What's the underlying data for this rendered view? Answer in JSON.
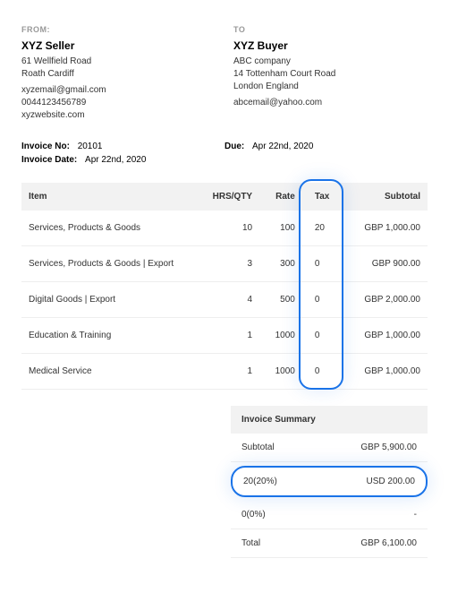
{
  "from_label": "FROM:",
  "to_label": "TO",
  "seller": {
    "name": "XYZ Seller",
    "addr1": "61 Wellfield Road",
    "addr2": "Roath Cardiff",
    "email": "xyzemail@gmail.com",
    "phone": "0044123456789",
    "web": "xyzwebsite.com"
  },
  "buyer": {
    "name": "XYZ Buyer",
    "company": "ABC company",
    "addr1": "14 Tottenham Court Road",
    "addr2": "London England",
    "email": "abcemail@yahoo.com"
  },
  "invoice_no_label": "Invoice No:",
  "invoice_no": "20101",
  "invoice_date_label": "Invoice Date:",
  "invoice_date": "Apr 22nd, 2020",
  "due_label": "Due:",
  "due_date": "Apr 22nd, 2020",
  "headers": {
    "item": "Item",
    "qty": "HRS/QTY",
    "rate": "Rate",
    "tax": "Tax",
    "subtotal": "Subtotal"
  },
  "items": [
    {
      "name": "Services, Products & Goods",
      "qty": "10",
      "rate": "100",
      "tax": "20",
      "subtotal": "GBP 1,000.00"
    },
    {
      "name": "Services, Products & Goods | Export",
      "qty": "3",
      "rate": "300",
      "tax": "0",
      "subtotal": "GBP 900.00"
    },
    {
      "name": "Digital Goods | Export",
      "qty": "4",
      "rate": "500",
      "tax": "0",
      "subtotal": "GBP 2,000.00"
    },
    {
      "name": "Education & Training",
      "qty": "1",
      "rate": "1000",
      "tax": "0",
      "subtotal": "GBP 1,000.00"
    },
    {
      "name": "Medical Service",
      "qty": "1",
      "rate": "1000",
      "tax": "0",
      "subtotal": "GBP 1,000.00"
    }
  ],
  "summary": {
    "title": "Invoice Summary",
    "subtotal_label": "Subtotal",
    "subtotal_value": "GBP 5,900.00",
    "tax20_label": "20(20%)",
    "tax20_value": "USD 200.00",
    "tax0_label": "0(0%)",
    "tax0_value": "-",
    "total_label": "Total",
    "total_value": "GBP 6,100.00"
  }
}
